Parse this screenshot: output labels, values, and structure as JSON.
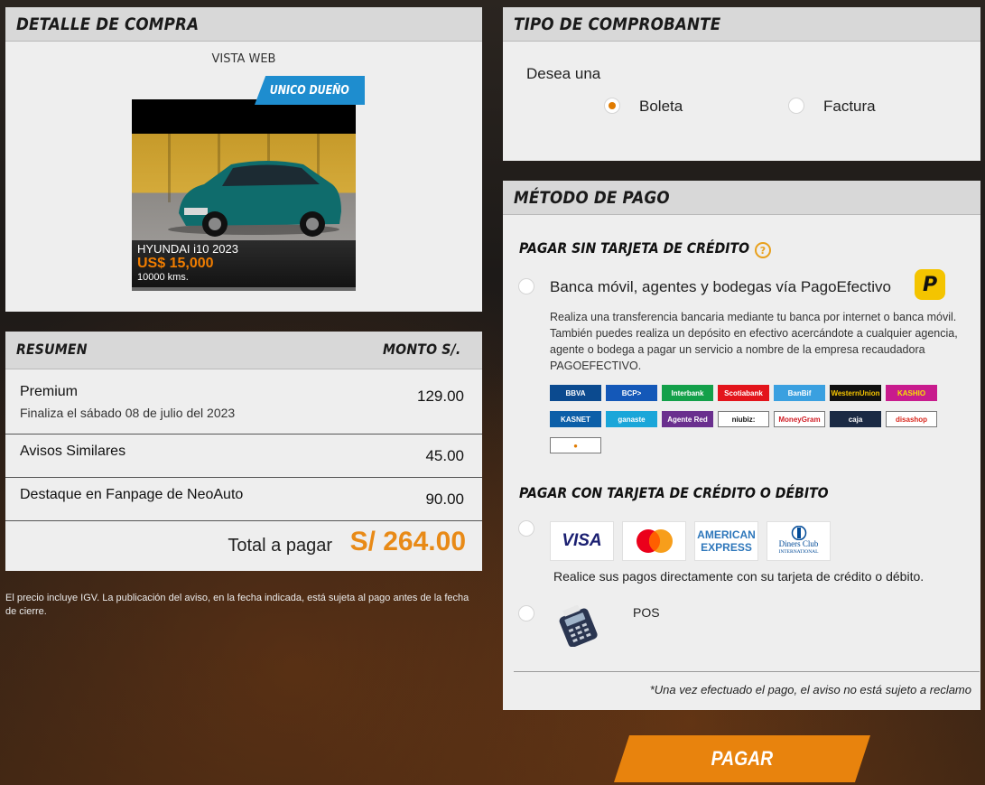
{
  "detalle": {
    "title": "DETALLE DE COMPRA",
    "vista": "VISTA WEB",
    "badge": "UNICO DUEÑO",
    "car": {
      "name": "HYUNDAI i10 2023",
      "price": "US$ 15,000",
      "kms": "10000 kms."
    }
  },
  "resumen": {
    "col_resumen": "RESUMEN",
    "col_monto": "MONTO S/.",
    "items": [
      {
        "name": "Premium",
        "sub": "Finaliza el sábado 08 de julio del 2023",
        "amount": "129.00"
      },
      {
        "name": "Avisos Similares",
        "amount": "45.00"
      },
      {
        "name": "Destaque en Fanpage de NeoAuto",
        "amount": "90.00"
      }
    ],
    "total_label": "Total a pagar",
    "total_value": "S/ 264.00"
  },
  "nota_igv": "El precio incluye IGV. La publicación del aviso, en la fecha indicada, está sujeta al pago antes de la fecha de cierre.",
  "comprobante": {
    "title": "TIPO DE COMPROBANTE",
    "prompt": "Desea una",
    "options": [
      {
        "label": "Boleta",
        "checked": true
      },
      {
        "label": "Factura",
        "checked": false
      }
    ]
  },
  "metodo": {
    "title": "MÉTODO DE PAGO",
    "sin_tarjeta_title": "PAGAR SIN TARJETA DE CRÉDITO",
    "help_icon": "question-circle-icon",
    "pagoefectivo_label": "Banca móvil, agentes y bodegas vía PagoEfectivo",
    "pagoefectivo_desc": "Realiza una transferencia bancaria mediante tu banca por internet o banca móvil. También puedes realiza un depósito en efectivo acercándote a cualquier agencia, agente o bodega a pagar un servicio a nombre de la empresa recaudadora PAGOEFECTIVO.",
    "banks": [
      {
        "label": "BBVA",
        "bg": "#0b4a8f",
        "fg": "#ffffff"
      },
      {
        "label": "BCP>",
        "bg": "#1458b8",
        "fg": "#ffffff"
      },
      {
        "label": "Interbank",
        "bg": "#13a04a",
        "fg": "#ffffff"
      },
      {
        "label": "Scotiabank",
        "bg": "#e3141b",
        "fg": "#ffffff"
      },
      {
        "label": "BanBif",
        "bg": "#3aa0e0",
        "fg": "#ffffff"
      },
      {
        "label": "WesternUnion",
        "bg": "#111111",
        "fg": "#f6c400"
      },
      {
        "label": "KASHIO",
        "bg": "#c81b8d",
        "fg": "#f4e200"
      },
      {
        "label": "KASNET",
        "bg": "#0c5fa8",
        "fg": "#ffffff"
      },
      {
        "label": "ganaste",
        "bg": "#1aa6d9",
        "fg": "#ffffff"
      },
      {
        "label": "Agente Red",
        "bg": "#6a2f8e",
        "fg": "#ffffff"
      },
      {
        "label": "niubiz:",
        "bg": "#ffffff",
        "fg": "#111111"
      },
      {
        "label": "MoneyGram",
        "bg": "#ffffff",
        "fg": "#d01c24"
      },
      {
        "label": "caja",
        "bg": "#1b2a44",
        "fg": "#ffffff"
      },
      {
        "label": "disashop",
        "bg": "#ffffff",
        "fg": "#d9261c"
      },
      {
        "label": "●",
        "bg": "#ffffff",
        "fg": "#e07b00"
      }
    ],
    "con_tarjeta_title": "PAGAR CON TARJETA DE CRÉDITO O DÉBITO",
    "cards": [
      {
        "name": "VISA",
        "icon": "visa-icon"
      },
      {
        "name": "Mastercard",
        "icon": "mastercard-icon"
      },
      {
        "name": "AMERICAN EXPRESS",
        "icon": "amex-icon"
      },
      {
        "name": "Diners Club INTERNATIONAL",
        "icon": "diners-icon"
      }
    ],
    "amex_line1": "AMERICAN",
    "amex_line2": "EXPRESS",
    "diners_line1": "Diners Club",
    "diners_line2": "INTERNATIONAL",
    "cards_note": "Realice sus pagos directamente con su tarjeta de crédito o débito.",
    "pos_label": "POS",
    "reclamo": "*Una vez efectuado el pago, el aviso no está sujeto a reclamo"
  },
  "pagar_label": "PAGAR"
}
